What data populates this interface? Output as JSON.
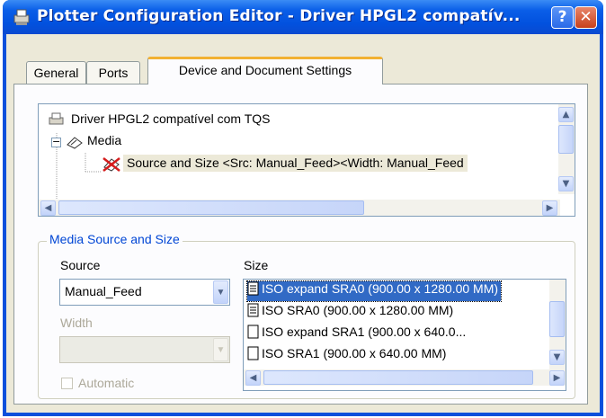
{
  "window": {
    "title": "Plotter Configuration Editor - Driver HPGL2 compatív...",
    "help_label": "?",
    "close_label": "✕"
  },
  "tabs": [
    {
      "label": "General"
    },
    {
      "label": "Ports"
    },
    {
      "label": "Device and Document Settings"
    }
  ],
  "tree": {
    "root_label": "Driver HPGL2 compatível com TQS",
    "media_label": "Media",
    "source_size_label": "Source and Size <Src:  Manual_Feed><Width: Manual_Feed"
  },
  "group": {
    "title": "Media Source and Size",
    "source_label": "Source",
    "source_value": "Manual_Feed",
    "width_label": "Width",
    "width_value": "",
    "automatic_label": "Automatic",
    "size_label": "Size",
    "sizes": [
      "ISO expand SRA0 (900.00 x 1280.00 MM)",
      "ISO SRA0 (900.00 x 1280.00 MM)",
      "ISO expand SRA1 (900.00 x 640.0...",
      "ISO SRA1 (900.00 x 640.00 MM)"
    ]
  },
  "colors": {
    "titlebar": "#0a5ee8",
    "selection": "#316ac5",
    "group_title": "#0046d5",
    "tab_highlight": "#f2b132"
  }
}
